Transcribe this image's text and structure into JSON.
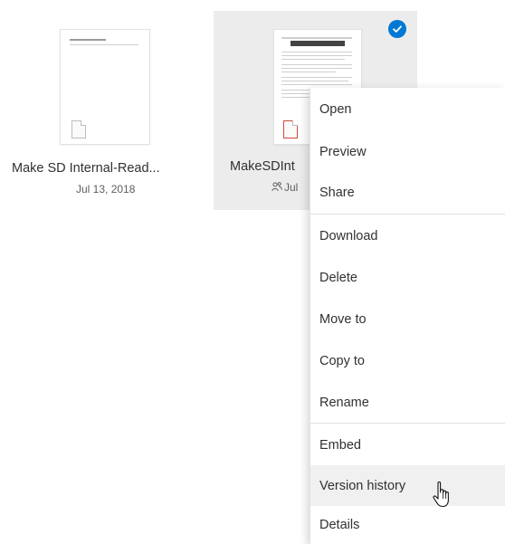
{
  "files": [
    {
      "name": "Make SD Internal-Read...",
      "date": "Jul 13, 2018"
    },
    {
      "name": "MakeSDInt",
      "date": "Jul",
      "selected": true,
      "shared": true
    }
  ],
  "context_menu": {
    "items": [
      {
        "label": "Open"
      },
      {
        "label": "Preview"
      },
      {
        "label": "Share"
      },
      {
        "label": "Download"
      },
      {
        "label": "Delete"
      },
      {
        "label": "Move to"
      },
      {
        "label": "Copy to"
      },
      {
        "label": "Rename"
      },
      {
        "label": "Embed"
      },
      {
        "label": "Version history",
        "hovered": true
      },
      {
        "label": "Details"
      }
    ]
  },
  "colors": {
    "selection_bg": "#ececec",
    "check_accent": "#0078d4",
    "hover_bg": "#f0f0f0"
  },
  "icons": [
    "check-icon",
    "shared-people-icon",
    "document-icon",
    "hand-pointer-cursor"
  ]
}
